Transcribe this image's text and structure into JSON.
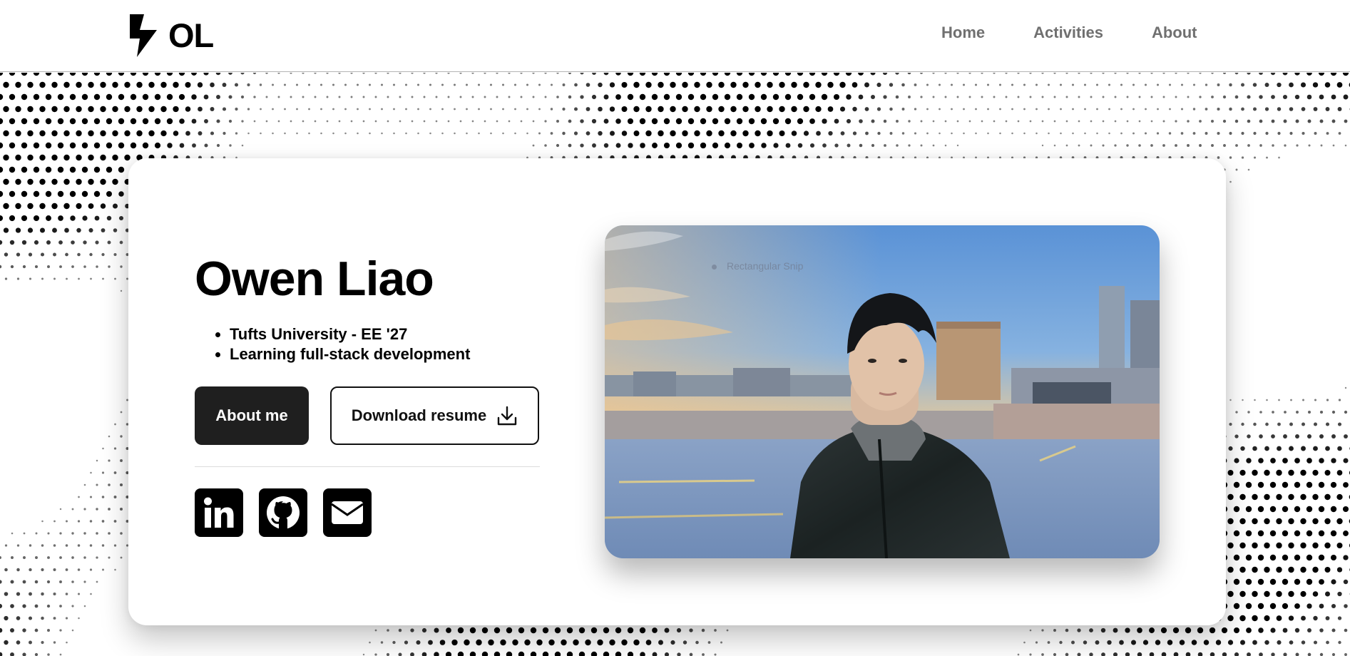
{
  "nav": {
    "brand_text": "OL",
    "brand_icon": "lightning-bolt-icon",
    "links": [
      "Home",
      "Activities",
      "About"
    ]
  },
  "hero": {
    "name": "Owen Liao",
    "facts": [
      "Tufts University - EE '27",
      "Learning full-stack development"
    ],
    "about_button": "About me",
    "resume_button": "Download resume",
    "resume_icon": "download-icon",
    "social_icons": [
      "linkedin-icon",
      "github-icon",
      "email-icon"
    ],
    "photo_caption": "Rectangular Snip"
  },
  "colors": {
    "accent_dark": "#1f1f1f",
    "nav_link": "#707070",
    "background": "#ffffff"
  }
}
